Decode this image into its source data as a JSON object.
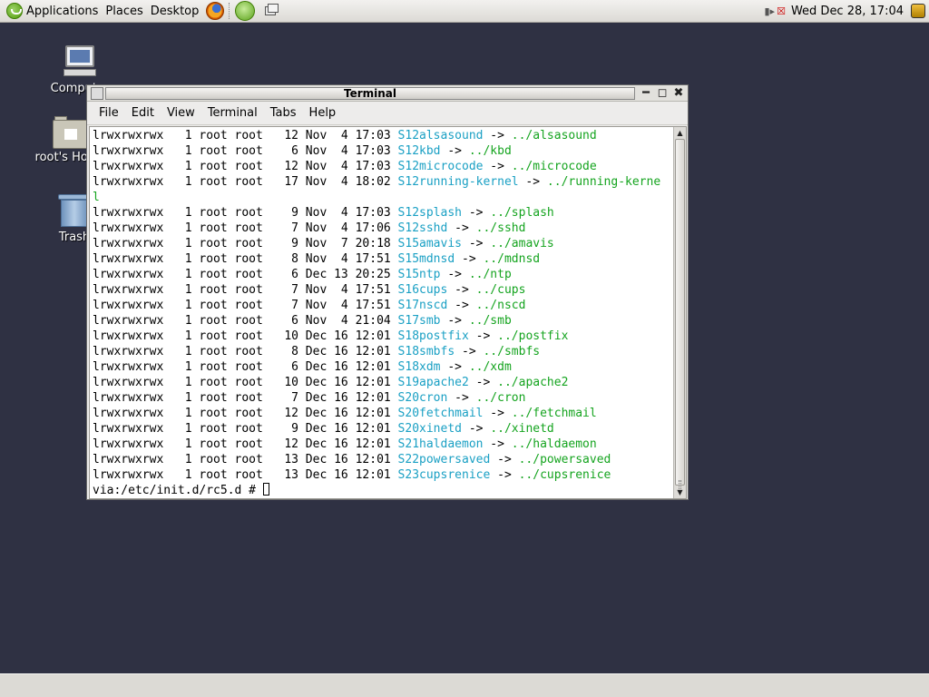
{
  "top_panel": {
    "menus": [
      "Applications",
      "Places",
      "Desktop"
    ],
    "clock": "Wed Dec 28, 17:04"
  },
  "desktop_icons": [
    {
      "label": "Computer",
      "icon": "computer-icon"
    },
    {
      "label": "root's Home",
      "icon": "home-folder-icon"
    },
    {
      "label": "Trash",
      "icon": "trash-icon"
    }
  ],
  "terminal": {
    "title": "Terminal",
    "menus": [
      "File",
      "Edit",
      "View",
      "Terminal",
      "Tabs",
      "Help"
    ],
    "lines": [
      {
        "perm": "lrwxrwxrwx",
        "n": "1",
        "user": "root",
        "group": "root",
        "size": "12",
        "date": "Nov  4 17:03",
        "link": "S12alsasound",
        "target": "../alsasound"
      },
      {
        "perm": "lrwxrwxrwx",
        "n": "1",
        "user": "root",
        "group": "root",
        "size": "6",
        "date": "Nov  4 17:03",
        "link": "S12kbd",
        "target": "../kbd"
      },
      {
        "perm": "lrwxrwxrwx",
        "n": "1",
        "user": "root",
        "group": "root",
        "size": "12",
        "date": "Nov  4 17:03",
        "link": "S12microcode",
        "target": "../microcode"
      },
      {
        "perm": "lrwxrwxrwx",
        "n": "1",
        "user": "root",
        "group": "root",
        "size": "17",
        "date": "Nov  4 18:02",
        "link": "S12running-kernel",
        "target": "../running-kerne",
        "wrap": "l"
      },
      {
        "perm": "lrwxrwxrwx",
        "n": "1",
        "user": "root",
        "group": "root",
        "size": "9",
        "date": "Nov  4 17:03",
        "link": "S12splash",
        "target": "../splash"
      },
      {
        "perm": "lrwxrwxrwx",
        "n": "1",
        "user": "root",
        "group": "root",
        "size": "7",
        "date": "Nov  4 17:06",
        "link": "S12sshd",
        "target": "../sshd"
      },
      {
        "perm": "lrwxrwxrwx",
        "n": "1",
        "user": "root",
        "group": "root",
        "size": "9",
        "date": "Nov  7 20:18",
        "link": "S15amavis",
        "target": "../amavis"
      },
      {
        "perm": "lrwxrwxrwx",
        "n": "1",
        "user": "root",
        "group": "root",
        "size": "8",
        "date": "Nov  4 17:51",
        "link": "S15mdnsd",
        "target": "../mdnsd"
      },
      {
        "perm": "lrwxrwxrwx",
        "n": "1",
        "user": "root",
        "group": "root",
        "size": "6",
        "date": "Dec 13 20:25",
        "link": "S15ntp",
        "target": "../ntp"
      },
      {
        "perm": "lrwxrwxrwx",
        "n": "1",
        "user": "root",
        "group": "root",
        "size": "7",
        "date": "Nov  4 17:51",
        "link": "S16cups",
        "target": "../cups"
      },
      {
        "perm": "lrwxrwxrwx",
        "n": "1",
        "user": "root",
        "group": "root",
        "size": "7",
        "date": "Nov  4 17:51",
        "link": "S17nscd",
        "target": "../nscd"
      },
      {
        "perm": "lrwxrwxrwx",
        "n": "1",
        "user": "root",
        "group": "root",
        "size": "6",
        "date": "Nov  4 21:04",
        "link": "S17smb",
        "target": "../smb"
      },
      {
        "perm": "lrwxrwxrwx",
        "n": "1",
        "user": "root",
        "group": "root",
        "size": "10",
        "date": "Dec 16 12:01",
        "link": "S18postfix",
        "target": "../postfix"
      },
      {
        "perm": "lrwxrwxrwx",
        "n": "1",
        "user": "root",
        "group": "root",
        "size": "8",
        "date": "Dec 16 12:01",
        "link": "S18smbfs",
        "target": "../smbfs"
      },
      {
        "perm": "lrwxrwxrwx",
        "n": "1",
        "user": "root",
        "group": "root",
        "size": "6",
        "date": "Dec 16 12:01",
        "link": "S18xdm",
        "target": "../xdm"
      },
      {
        "perm": "lrwxrwxrwx",
        "n": "1",
        "user": "root",
        "group": "root",
        "size": "10",
        "date": "Dec 16 12:01",
        "link": "S19apache2",
        "target": "../apache2"
      },
      {
        "perm": "lrwxrwxrwx",
        "n": "1",
        "user": "root",
        "group": "root",
        "size": "7",
        "date": "Dec 16 12:01",
        "link": "S20cron",
        "target": "../cron"
      },
      {
        "perm": "lrwxrwxrwx",
        "n": "1",
        "user": "root",
        "group": "root",
        "size": "12",
        "date": "Dec 16 12:01",
        "link": "S20fetchmail",
        "target": "../fetchmail"
      },
      {
        "perm": "lrwxrwxrwx",
        "n": "1",
        "user": "root",
        "group": "root",
        "size": "9",
        "date": "Dec 16 12:01",
        "link": "S20xinetd",
        "target": "../xinetd"
      },
      {
        "perm": "lrwxrwxrwx",
        "n": "1",
        "user": "root",
        "group": "root",
        "size": "12",
        "date": "Dec 16 12:01",
        "link": "S21haldaemon",
        "target": "../haldaemon"
      },
      {
        "perm": "lrwxrwxrwx",
        "n": "1",
        "user": "root",
        "group": "root",
        "size": "13",
        "date": "Dec 16 12:01",
        "link": "S22powersaved",
        "target": "../powersaved"
      },
      {
        "perm": "lrwxrwxrwx",
        "n": "1",
        "user": "root",
        "group": "root",
        "size": "13",
        "date": "Dec 16 12:01",
        "link": "S23cupsrenice",
        "target": "../cupsrenice"
      }
    ],
    "prompt": "via:/etc/init.d/rc5.d # "
  },
  "colors": {
    "desktop_bg": "#2f3143",
    "symlink_name": "#1aa0c4",
    "symlink_target": "#15a41f"
  }
}
